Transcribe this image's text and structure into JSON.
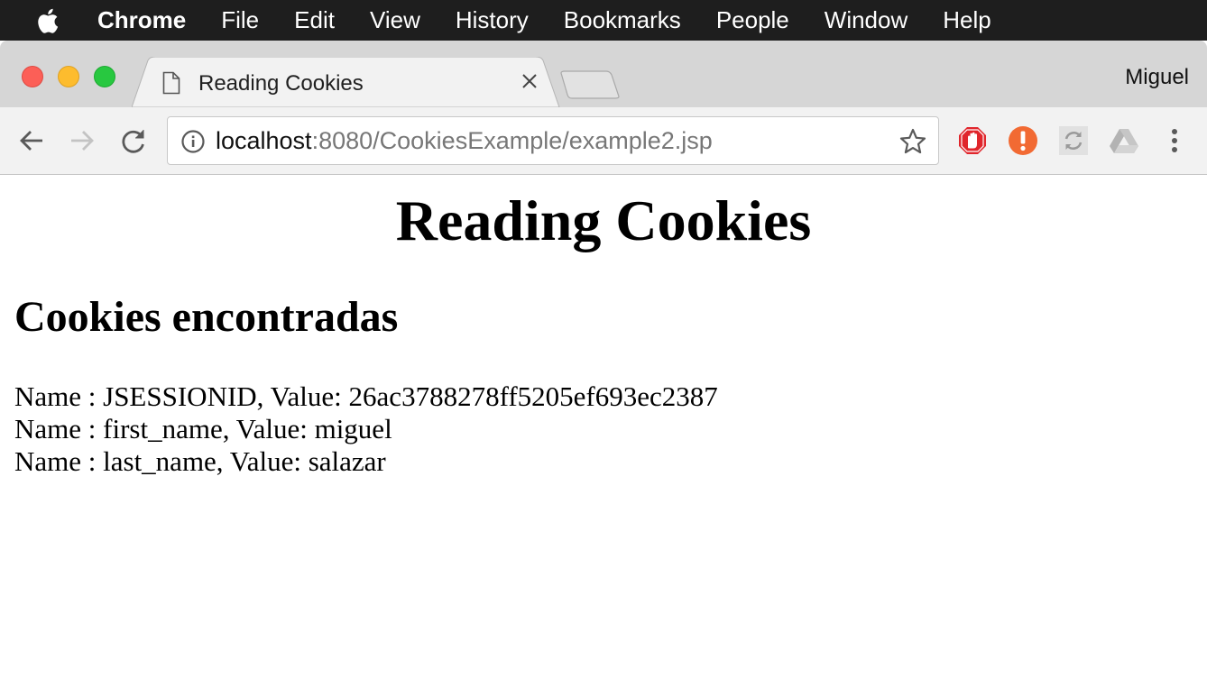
{
  "menubar": {
    "app_name": "Chrome",
    "items": [
      "File",
      "Edit",
      "View",
      "History",
      "Bookmarks",
      "People",
      "Window",
      "Help"
    ]
  },
  "window": {
    "tab": {
      "title": "Reading Cookies",
      "icon": "document-icon"
    },
    "profile_name": "Miguel"
  },
  "toolbar": {
    "url_host": "localhost",
    "url_rest": ":8080/CookiesExample/example2.jsp",
    "extensions": [
      "adblock-icon",
      "alert-icon",
      "sync-icon",
      "drive-icon"
    ]
  },
  "page": {
    "title": "Reading Cookies",
    "subtitle": "Cookies encontradas",
    "cookies": [
      "Name : JSESSIONID, Value: 26ac3788278ff5205ef693ec2387",
      "Name : first_name, Value: miguel",
      "Name : last_name, Value: salazar"
    ]
  },
  "colors": {
    "menubar_bg": "#1e1e1e",
    "tabstrip_bg": "#d6d6d6",
    "toolbar_bg": "#f2f2f2",
    "close": "#fc5f57",
    "minimize": "#fdbc2e",
    "maximize": "#28c840",
    "adblock_red": "#e0262c",
    "alert_orange": "#f26a33"
  }
}
